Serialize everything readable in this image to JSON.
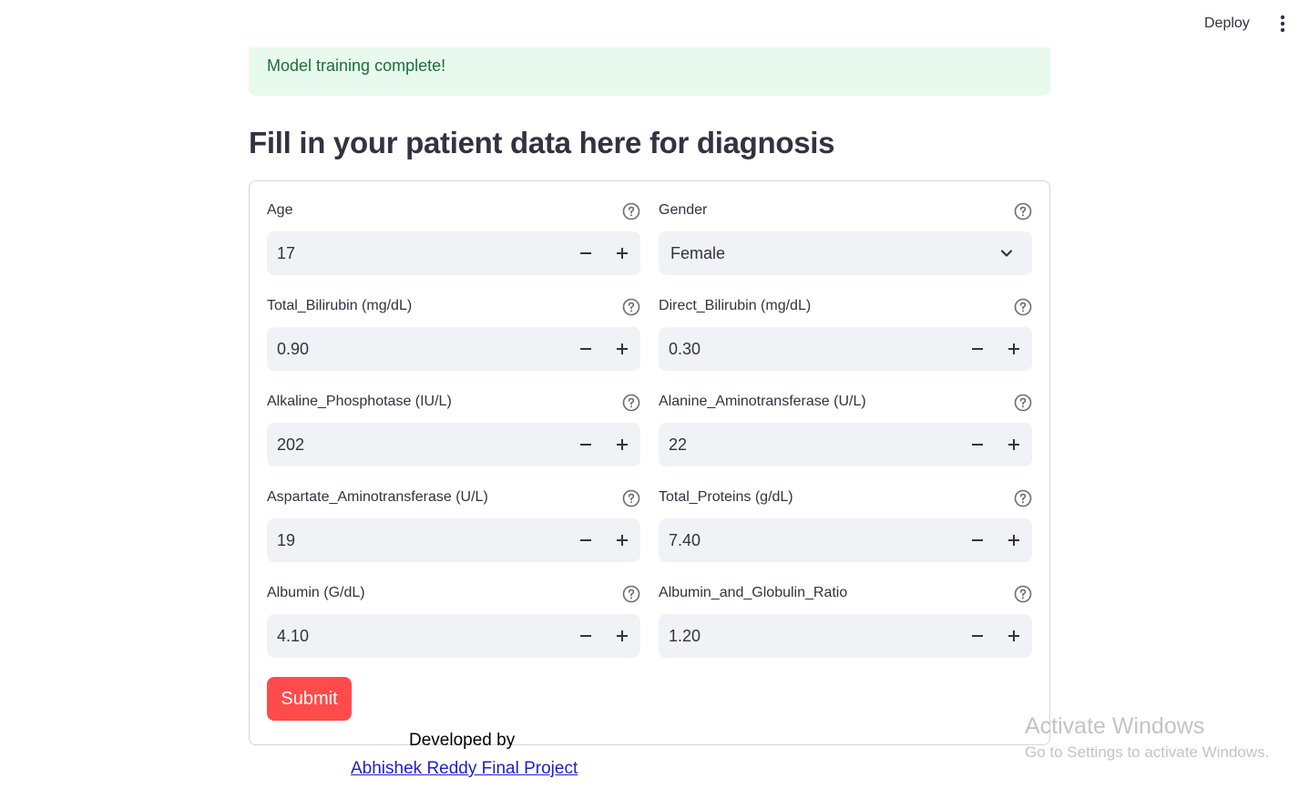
{
  "header": {
    "deploy_label": "Deploy",
    "menu_icon": "more-vertical-icon"
  },
  "alert": {
    "text": "Model training complete!",
    "background": "#e8f9ee",
    "text_color": "#177233"
  },
  "page_title": "Fill in your patient data here for diagnosis",
  "form": {
    "fields": [
      {
        "label": "Age",
        "value": "17",
        "type": "number"
      },
      {
        "label": "Gender",
        "value": "Female",
        "type": "select"
      },
      {
        "label": "Total_Bilirubin (mg/dL)",
        "value": "0.90",
        "type": "number"
      },
      {
        "label": "Direct_Bilirubin (mg/dL)",
        "value": "0.30",
        "type": "number"
      },
      {
        "label": "Alkaline_Phosphotase (IU/L)",
        "value": "202",
        "type": "number"
      },
      {
        "label": "Alanine_Aminotransferase (U/L)",
        "value": "22",
        "type": "number"
      },
      {
        "label": "Aspartate_Aminotransferase (U/L)",
        "value": "19",
        "type": "number"
      },
      {
        "label": "Total_Proteins (g/dL)",
        "value": "7.40",
        "type": "number"
      },
      {
        "label": "Albumin (G/dL)",
        "value": "4.10",
        "type": "number"
      },
      {
        "label": "Albumin_and_Globulin_Ratio",
        "value": "1.20",
        "type": "number"
      }
    ],
    "submit_label": "Submit",
    "submit_color": "#ff4b4b"
  },
  "footer": {
    "developed_by": "Developed by",
    "link_text": "Abhishek Reddy Final Project"
  },
  "watermark": {
    "title": "Activate Windows",
    "subtitle": "Go to Settings to activate Windows."
  }
}
